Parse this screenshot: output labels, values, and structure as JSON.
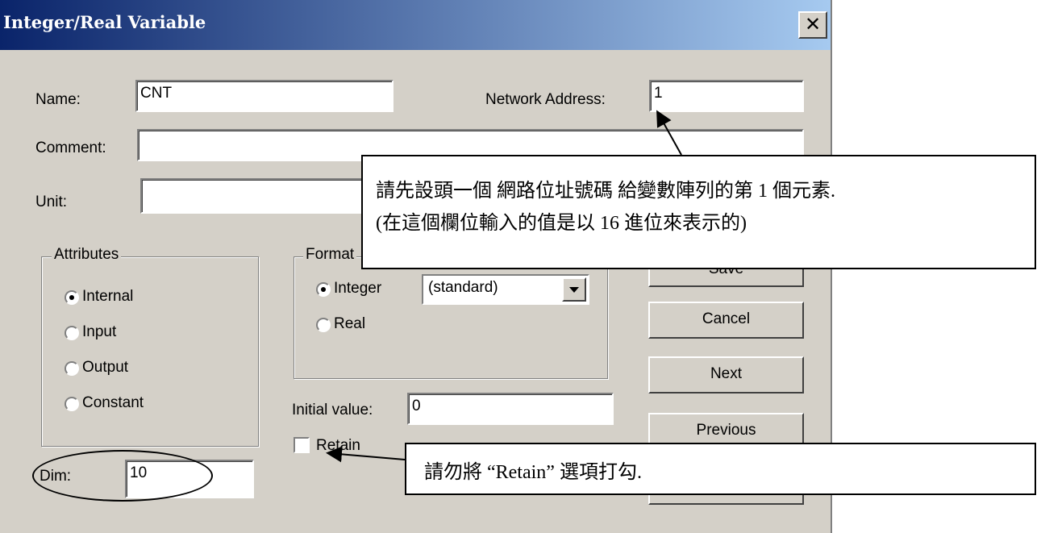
{
  "dialog": {
    "title": "Integer/Real Variable",
    "close_label": "✕",
    "name_label": "Name:",
    "name_value": "CNT",
    "network_address_label": "Network Address:",
    "network_address_value": "1",
    "comment_label": "Comment:",
    "comment_value": "",
    "unit_label": "Unit:",
    "unit_value": "",
    "attributes": {
      "legend": "Attributes",
      "options": [
        {
          "label": "Internal",
          "selected": true
        },
        {
          "label": "Input",
          "selected": false
        },
        {
          "label": "Output",
          "selected": false
        },
        {
          "label": "Constant",
          "selected": false
        }
      ]
    },
    "format": {
      "legend": "Format",
      "options": [
        {
          "label": "Integer",
          "selected": true
        },
        {
          "label": "Real",
          "selected": false
        }
      ],
      "select_value": "(standard)"
    },
    "initial_value_label": "Initial value:",
    "initial_value": "0",
    "retain_label": "Retain",
    "retain_checked": false,
    "dim_label": "Dim:",
    "dim_value": "10",
    "buttons": {
      "ok": "Save",
      "cancel": "Cancel",
      "next": "Next",
      "previous": "Previous"
    }
  },
  "annotations": {
    "callout_network_line1": "請先設頭一個  網路位址號碼  給變數陣列的第 1 個元素.",
    "callout_network_line2": "(在這個欄位輸入的值是以  16 進位來表示的)",
    "callout_retain": "請勿將 “Retain” 選項打勾."
  }
}
